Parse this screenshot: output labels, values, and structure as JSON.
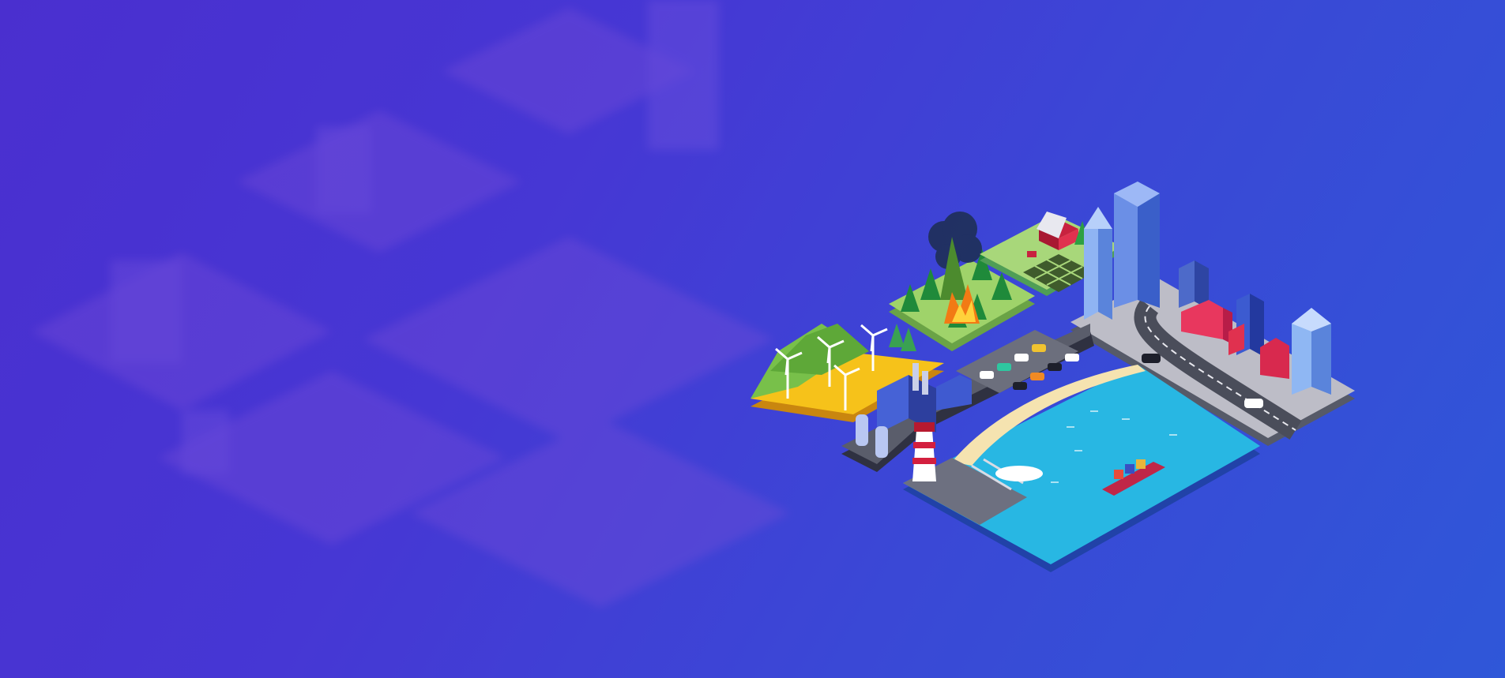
{
  "scene": {
    "background": {
      "gradient_start": "#4a2fcf",
      "gradient_end": "#2f57d8"
    },
    "tiles": [
      {
        "name": "wind-farm",
        "color": "#f6c21a"
      },
      {
        "name": "forest-fire",
        "color": "#9fd36a"
      },
      {
        "name": "farm",
        "color": "#a8d77a"
      },
      {
        "name": "city",
        "color": "#bdbdc7"
      },
      {
        "name": "parking-factory",
        "color": "#5a5d6b"
      },
      {
        "name": "harbor-sea",
        "color": "#28b7e3"
      }
    ],
    "icons": [
      "wind-turbine-icon",
      "factory-icon",
      "lighthouse-icon",
      "ship-icon",
      "skyscraper-icon",
      "barn-icon",
      "fire-icon",
      "car-icon"
    ]
  }
}
